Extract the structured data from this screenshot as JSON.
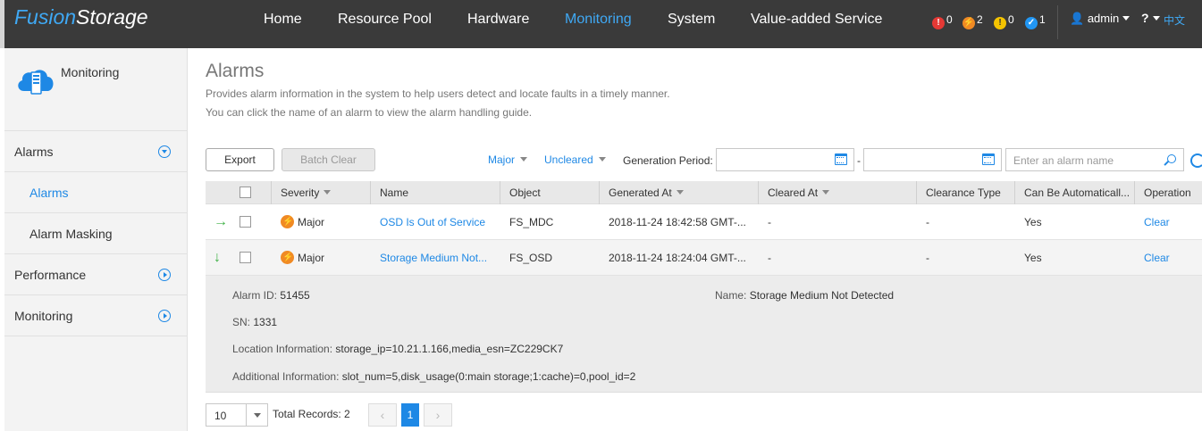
{
  "app": {
    "logo_part1": "Fusion",
    "logo_part2": "Storage"
  },
  "nav": {
    "items": [
      "Home",
      "Resource Pool",
      "Hardware",
      "Monitoring",
      "System",
      "Value-added Service"
    ],
    "active": "Monitoring"
  },
  "alarm_counts": [
    {
      "icon": "critical-alarm-icon",
      "count": "0",
      "color": "#e53935"
    },
    {
      "icon": "major-alarm-icon",
      "count": "2",
      "color": "#f08a24"
    },
    {
      "icon": "minor-alarm-icon",
      "count": "0",
      "color": "#f5c400"
    },
    {
      "icon": "warning-alarm-icon",
      "count": "1",
      "color": "#2196f3"
    }
  ],
  "user": {
    "name": "admin",
    "help": "?",
    "language": "中文"
  },
  "sidebar": {
    "title": "Monitoring",
    "items": [
      {
        "label": "Alarms",
        "type": "group",
        "expanded": true
      },
      {
        "label": "Alarms",
        "type": "sub",
        "selected": true
      },
      {
        "label": "Alarm Masking",
        "type": "sub",
        "selected": false
      },
      {
        "label": "Performance",
        "type": "group",
        "expanded": false
      },
      {
        "label": "Monitoring",
        "type": "group",
        "expanded": false
      }
    ]
  },
  "page": {
    "title": "Alarms",
    "description_1": "Provides alarm information in the system to help users detect and locate faults in a timely manner.",
    "description_2": "You can click the name of an alarm to view the alarm handling guide."
  },
  "toolbar": {
    "export_label": "Export",
    "batch_clear_label": "Batch Clear",
    "severity_filter": "Major",
    "status_filter": "Uncleared",
    "generation_period_label": "Generation Period:",
    "date_separator": "-",
    "search_placeholder": "Enter an alarm name"
  },
  "table": {
    "columns": [
      "Severity",
      "Name",
      "Object",
      "Generated At",
      "Cleared At",
      "Clearance Type",
      "Can Be Automaticall...",
      "Operation"
    ],
    "rows": [
      {
        "severity": "Major",
        "name": "OSD Is Out of Service",
        "object": "FS_MDC",
        "generated_at": "2018-11-24 18:42:58 GMT-...",
        "cleared_at": "-",
        "clearance_type": "-",
        "auto_clear": "Yes",
        "operation": "Clear",
        "expanded": false
      },
      {
        "severity": "Major",
        "name": "Storage Medium Not...",
        "object": "FS_OSD",
        "generated_at": "2018-11-24 18:24:04 GMT-...",
        "cleared_at": "-",
        "clearance_type": "-",
        "auto_clear": "Yes",
        "operation": "Clear",
        "expanded": true
      }
    ],
    "detail": {
      "alarm_id_label": "Alarm ID:",
      "alarm_id": "51455",
      "name_label": "Name:",
      "name": "Storage Medium Not Detected",
      "sn_label": "SN:",
      "sn": "1331",
      "location_label": "Location Information:",
      "location": "storage_ip=10.21.1.166,media_esn=ZC229CK7",
      "additional_label": "Additional Information:",
      "additional": "slot_num=5,disk_usage(0:main storage;1:cache)=0,pool_id=2"
    }
  },
  "pagination": {
    "page_size": "10",
    "total_label": "Total Records: 2",
    "current_page": "1",
    "prev": "‹",
    "next": "›"
  }
}
